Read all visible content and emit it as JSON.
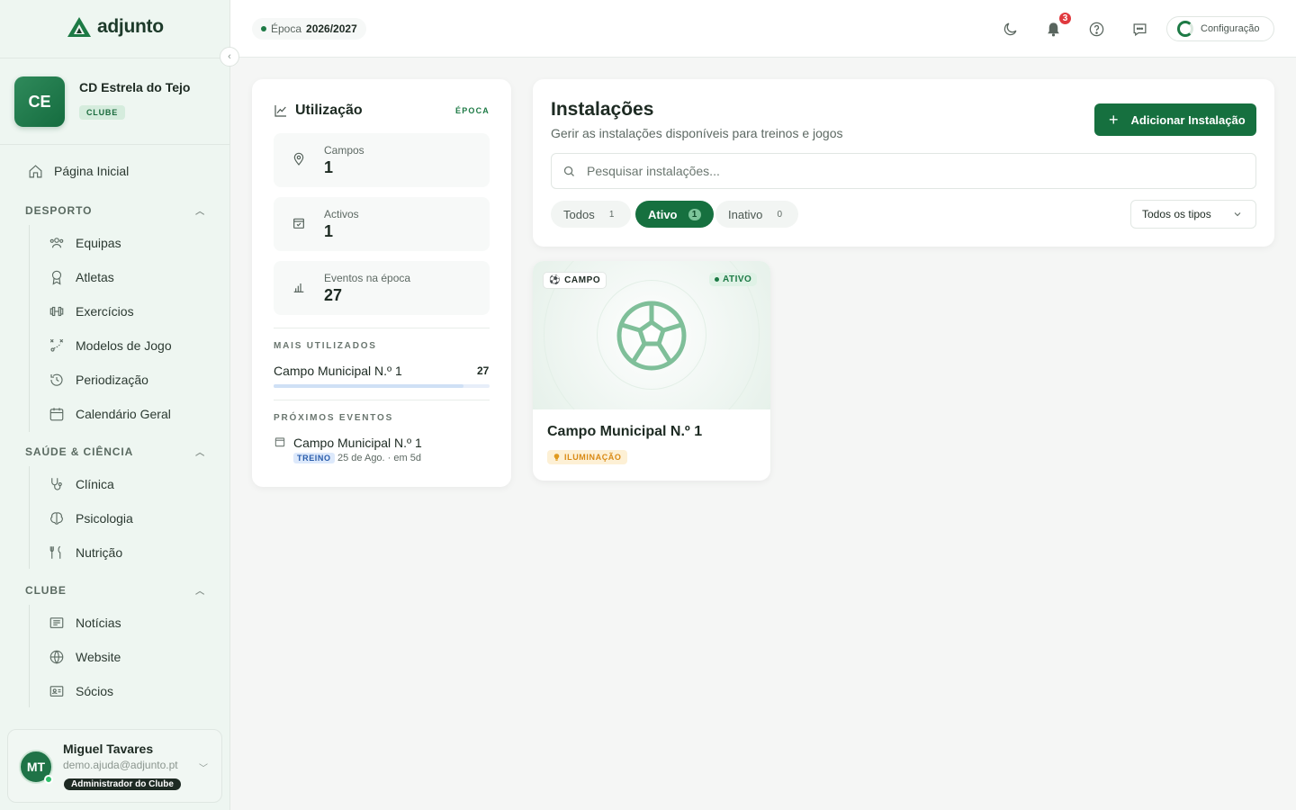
{
  "app": {
    "name": "adjunto"
  },
  "club": {
    "initials": "CE",
    "name": "CD Estrela do Tejo",
    "badge": "CLUBE"
  },
  "nav": {
    "home": "Página Inicial",
    "sections": [
      {
        "title": "DESPORTO",
        "items": [
          "Equipas",
          "Atletas",
          "Exercícios",
          "Modelos de Jogo",
          "Periodização",
          "Calendário Geral"
        ]
      },
      {
        "title": "SAÚDE & CIÊNCIA",
        "items": [
          "Clínica",
          "Psicologia",
          "Nutrição"
        ]
      },
      {
        "title": "CLUBE",
        "items": [
          "Notícias",
          "Website",
          "Sócios"
        ]
      }
    ]
  },
  "user": {
    "initials": "MT",
    "name": "Miguel Tavares",
    "email": "demo.ajuda@adjunto.pt",
    "role": "Administrador do Clube"
  },
  "topbar": {
    "season_label": "Época",
    "season_value": "2026/2027",
    "notifications": "3",
    "config_label": "Configuração"
  },
  "usage": {
    "title": "Utilização",
    "period": "ÉPOCA",
    "stats": [
      {
        "label": "Campos",
        "value": "1"
      },
      {
        "label": "Activos",
        "value": "1"
      },
      {
        "label": "Eventos na época",
        "value": "27"
      }
    ],
    "most_used_title": "MAIS UTILIZADOS",
    "most_used": {
      "name": "Campo Municipal N.º 1",
      "count": "27",
      "fraction": 0.88
    },
    "upcoming_title": "PRÓXIMOS EVENTOS",
    "upcoming": {
      "name": "Campo Municipal N.º 1",
      "tag": "TREINO",
      "meta": "25 de Ago. · em 5d"
    }
  },
  "installations": {
    "title": "Instalações",
    "subtitle": "Gerir as instalações disponíveis para treinos e jogos",
    "add_label": "Adicionar Instalação",
    "search_placeholder": "Pesquisar instalações...",
    "filters": [
      {
        "label": "Todos",
        "count": "1"
      },
      {
        "label": "Ativo",
        "count": "1"
      },
      {
        "label": "Inativo",
        "count": "0"
      }
    ],
    "type_select": "Todos os tipos"
  },
  "facility": {
    "type": "CAMPO",
    "status": "ATIVO",
    "name": "Campo Municipal N.º 1",
    "feature": "ILUMINAÇÃO"
  },
  "colors": {
    "accent": "#16703f",
    "sidebar_bg": "#eef6f1",
    "alert": "#e0393e"
  }
}
